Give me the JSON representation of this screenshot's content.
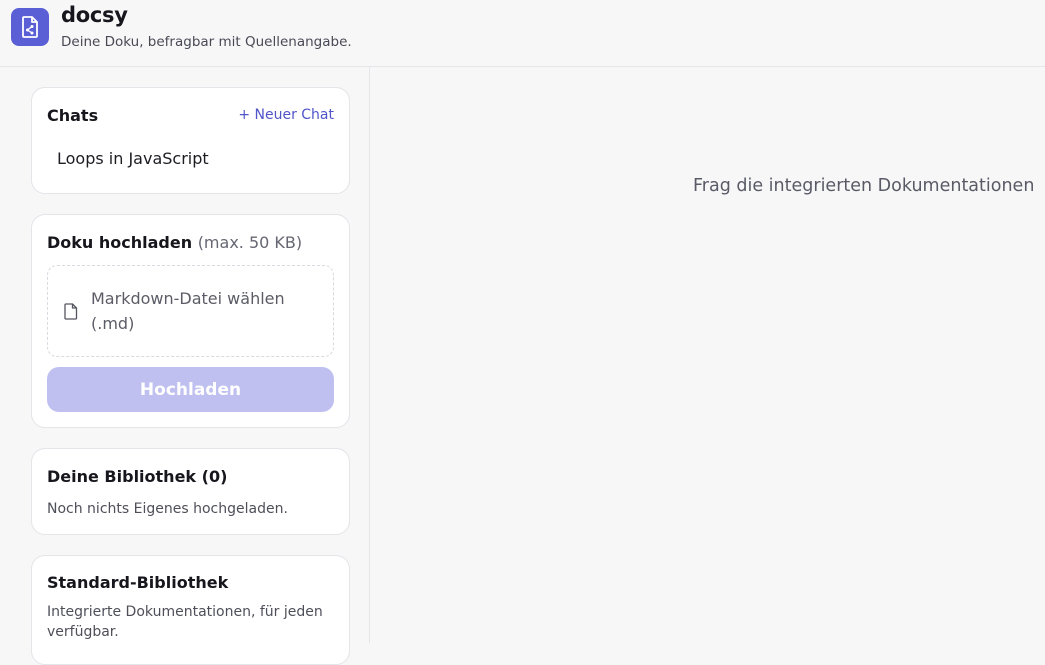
{
  "header": {
    "title": "docsy",
    "subtitle": "Deine Doku, befragbar mit Quellenangabe.",
    "logo_icon": "document-share-icon",
    "accent_color": "#5b5fd6"
  },
  "chats": {
    "title": "Chats",
    "new_chat_label": "+ Neuer Chat",
    "items": [
      {
        "label": "Loops in JavaScript"
      }
    ]
  },
  "upload": {
    "title": "Doku hochladen",
    "limit_hint": "(max. 50 KB)",
    "dropzone_text": "Markdown-Datei wählen (.md)",
    "dropzone_icon": "file-icon",
    "button_label": "Hochladen",
    "button_color": "#bfc0f0"
  },
  "library": {
    "title": "Deine Bibliothek (0)",
    "empty_text": "Noch nichts Eigenes hochgeladen."
  },
  "standard_library": {
    "title": "Standard-Bibliothek",
    "description": "Integrierte Dokumentationen, für jeden verfügbar."
  },
  "main": {
    "hint": "Frag die integrierten Dokumentationen"
  }
}
